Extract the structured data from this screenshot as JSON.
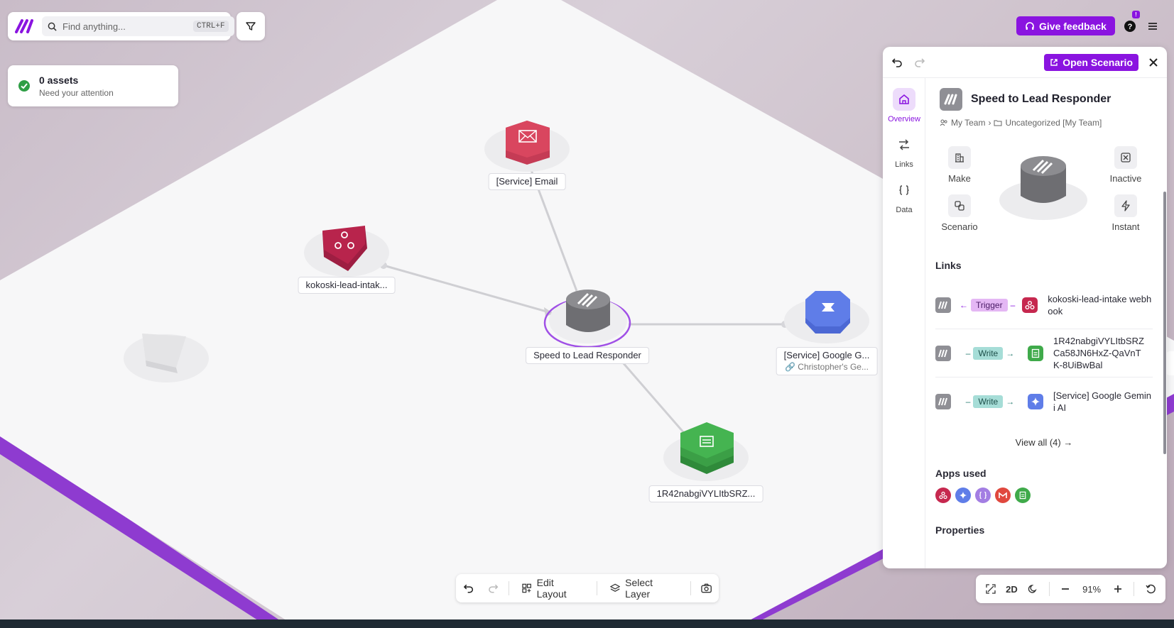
{
  "search": {
    "placeholder": "Find anything...",
    "shortcut": "CTRL+F"
  },
  "assets_card": {
    "count_label": "0 assets",
    "sub_label": "Need your attention"
  },
  "header": {
    "feedback_label": "Give feedback",
    "notification_badge": "!"
  },
  "graph": {
    "nodes": [
      {
        "label": "[Service] Email",
        "color": "#d9465f",
        "icon": "envelope-icon"
      },
      {
        "label": "kokoski-lead-intak...",
        "color": "#b8244c",
        "icon": "webhook-icon"
      },
      {
        "label": "Speed to Lead Responder",
        "color": "#858589",
        "icon": "make-logo-icon"
      },
      {
        "label": "[Service] Google G...",
        "sub": "Christopher's Ge...",
        "color": "#5f7de8",
        "icon": "gemini-icon"
      },
      {
        "label": "1R42nabgiVYLItbSRZ...",
        "color": "#3faa4a",
        "icon": "sheets-icon"
      }
    ]
  },
  "bottom_toolbar": {
    "edit_layout": "Edit Layout",
    "select_layer": "Select Layer"
  },
  "zoom": {
    "mode": "2D",
    "level": "91%"
  },
  "panel": {
    "open_scenario": "Open Scenario",
    "nav": [
      {
        "label": "Overview",
        "icon": "home-icon"
      },
      {
        "label": "Links",
        "icon": "links-icon"
      },
      {
        "label": "Data",
        "icon": "braces-icon"
      }
    ],
    "title": "Speed to Lead Responder",
    "breadcrumb": {
      "team": "My Team",
      "folder": "Uncategorized [My Team]"
    },
    "meta": {
      "make": "Make",
      "scenario": "Scenario",
      "inactive": "Inactive",
      "instant": "Instant"
    },
    "links_title": "Links",
    "links": [
      {
        "type": "Trigger",
        "target": "kokoski-lead-intake webhook"
      },
      {
        "type": "Write",
        "target": "1R42nabgiVYLItbSRZCa58JN6HxZ-QaVnTK-8UiBwBal"
      },
      {
        "type": "Write",
        "target": "[Service] Google Gemini AI"
      }
    ],
    "view_all": "View all (4) →",
    "apps_title": "Apps used",
    "apps": [
      {
        "icon": "webhook-icon",
        "color": "#c6284f"
      },
      {
        "icon": "gemini-icon",
        "color": "#5f7de8"
      },
      {
        "icon": "json-icon",
        "color": "#a37ee3"
      },
      {
        "icon": "gmail-icon",
        "color": "#e0483e"
      },
      {
        "icon": "sheets-icon",
        "color": "#3faa4a"
      }
    ],
    "properties_title": "Properties"
  },
  "colors": {
    "accent": "#8a14e0"
  }
}
